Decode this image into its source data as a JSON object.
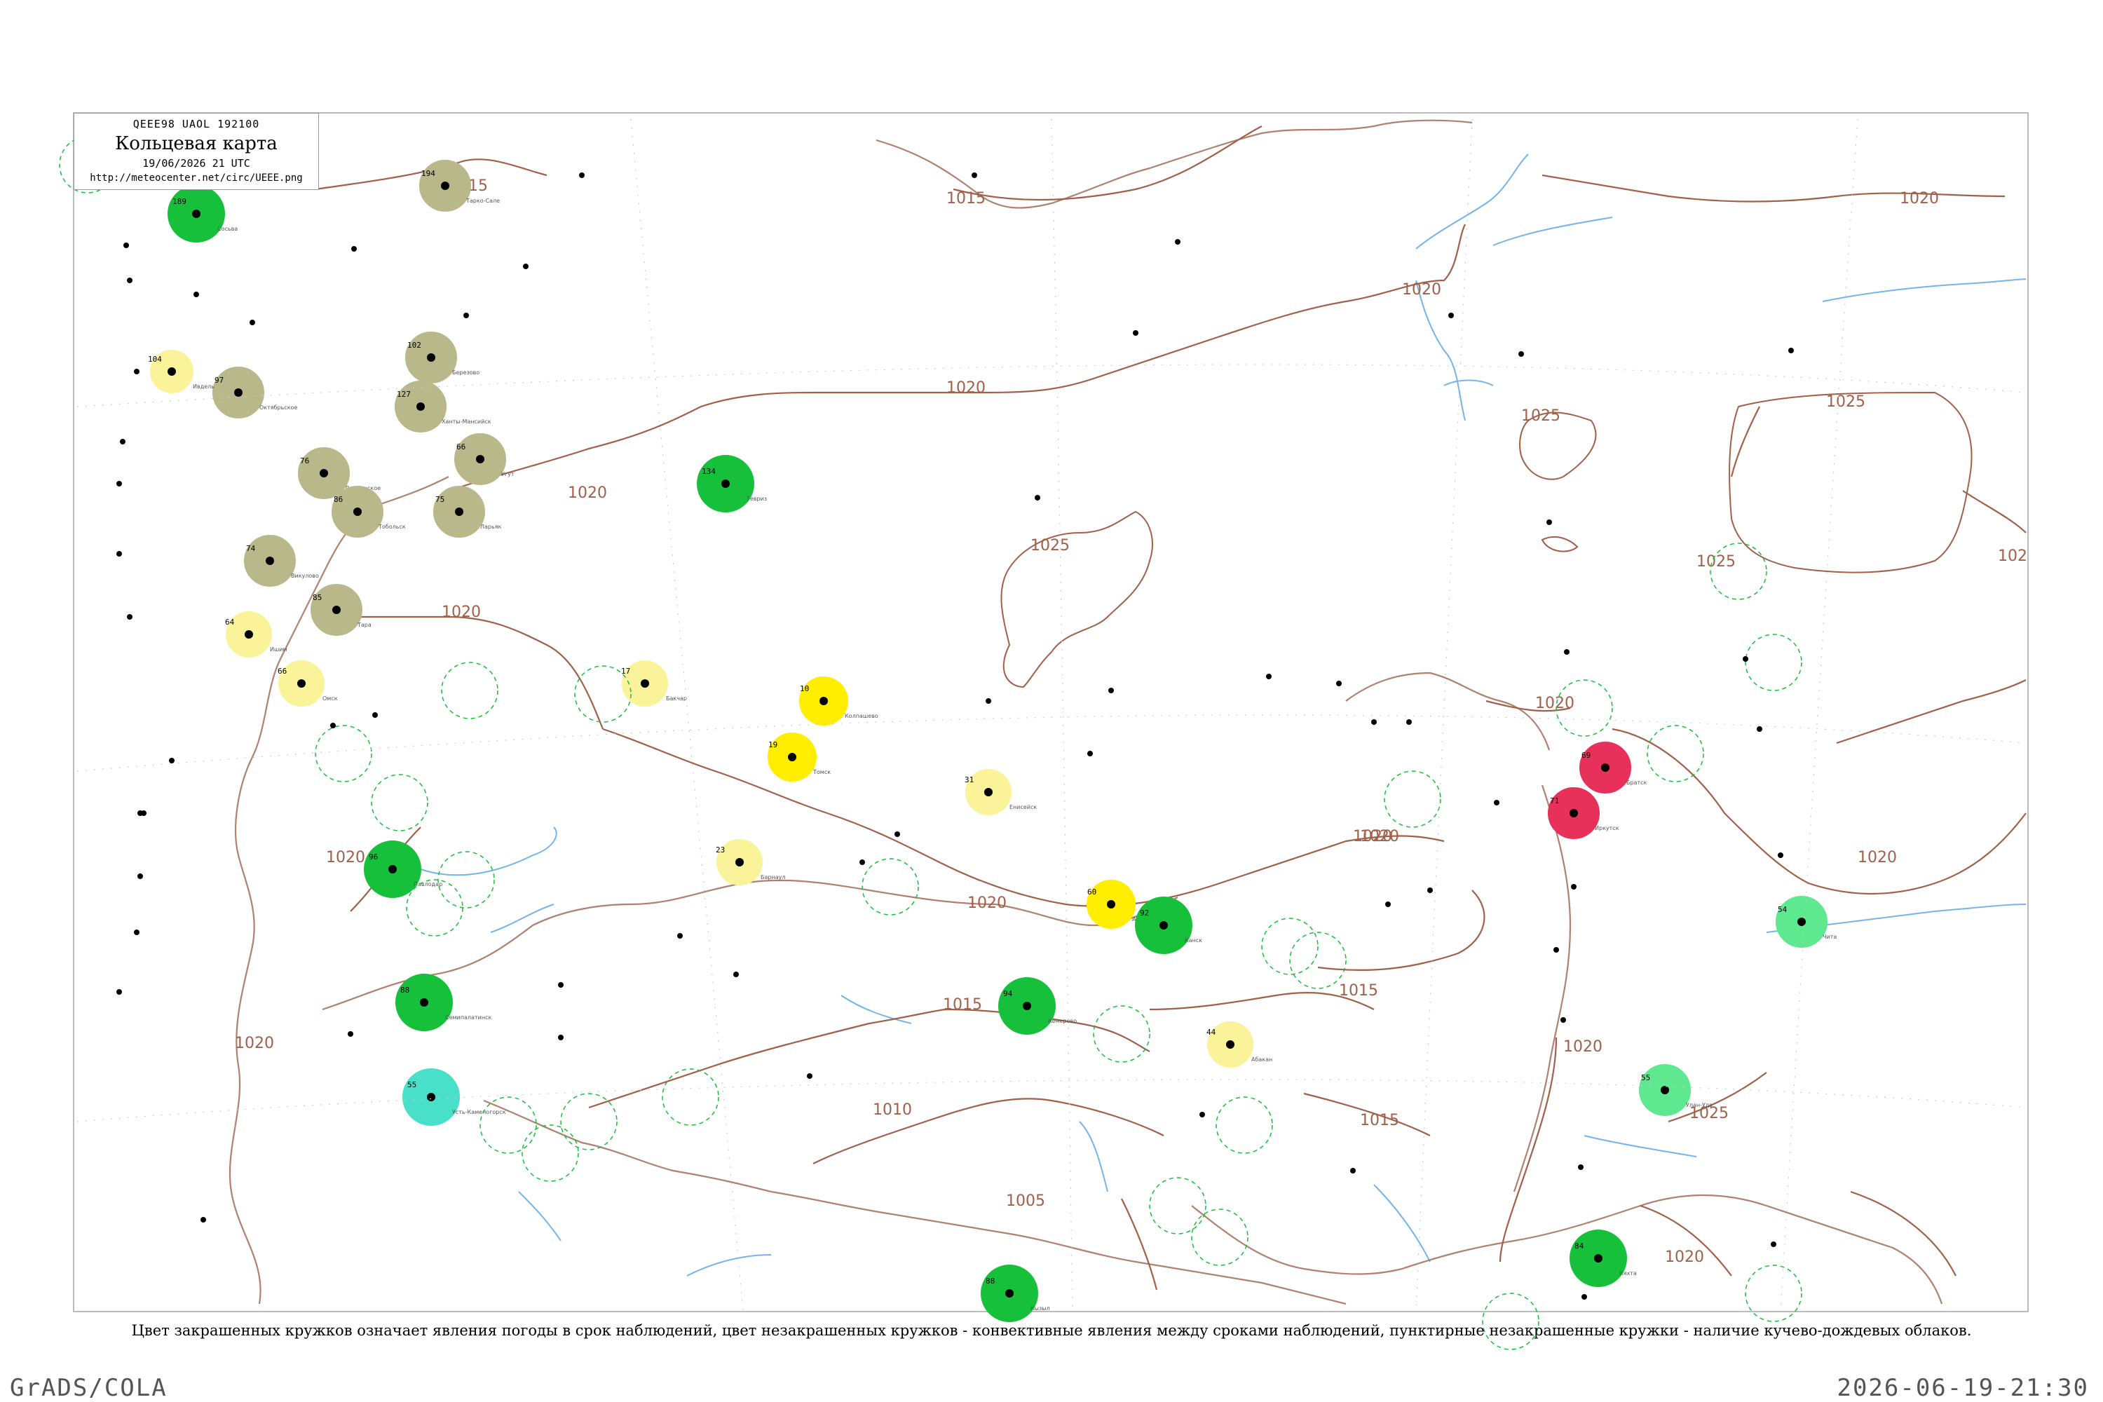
{
  "header": {
    "code_line": "QEEE98  UAOL  192100",
    "title": "Кольцевая карта",
    "date_line": "19/06/2026 21 UTC",
    "url": "http://meteocenter.net/circ/UEEE.png"
  },
  "caption": "Цвет закрашенных кружков означает явления погоды в срок наблюдений, цвет незакрашенных кружков - конвективные явления между сроками наблюдений, пунктирные незакрашенные кружки - наличие кучево-дождевых облаков.",
  "footer": {
    "left": "GrADS/COLA",
    "right": "2026-06-19-21:30"
  },
  "colors": {
    "isobar": "#a0604a",
    "river": "#74b4e8",
    "green_station": "#17c03a",
    "olive_station": "#b9b88a",
    "yellow_station": "#ffee00",
    "pale_yellow_station": "#fbf39a",
    "red_station": "#e8315a",
    "light_green_station": "#5ee890",
    "cyan_station": "#48e0c8"
  },
  "isobar_labels": [
    {
      "text": "1015"
    },
    {
      "text": "1015"
    },
    {
      "text": "1020"
    },
    {
      "text": "1020"
    },
    {
      "text": "1020"
    },
    {
      "text": "1020"
    },
    {
      "text": "1020"
    },
    {
      "text": "1025"
    },
    {
      "text": "1025"
    },
    {
      "text": "1025"
    },
    {
      "text": "1020"
    },
    {
      "text": "1025"
    },
    {
      "text": "102"
    },
    {
      "text": "1020"
    },
    {
      "text": "1020"
    },
    {
      "text": "1020"
    },
    {
      "text": "1020"
    },
    {
      "text": "1015"
    },
    {
      "text": "1020"
    },
    {
      "text": "1015"
    },
    {
      "text": "1010"
    },
    {
      "text": "1005"
    },
    {
      "text": "1015"
    },
    {
      "text": "1020"
    },
    {
      "text": "1025"
    },
    {
      "text": "1020"
    },
    {
      "text": "1020"
    }
  ],
  "stations": [
    {
      "type": "green",
      "num": "189",
      "name": "Сосьва"
    },
    {
      "type": "olive",
      "num": "194",
      "name": "Тарко-Сале"
    },
    {
      "type": "olive",
      "num": "102",
      "name": "Березово"
    },
    {
      "type": "olive",
      "num": "127",
      "name": "Ханты-Мансийск"
    },
    {
      "type": "olive",
      "num": "66",
      "name": "Угут"
    },
    {
      "type": "olive",
      "num": "76",
      "name": "Демьянское"
    },
    {
      "type": "olive",
      "num": "86",
      "name": "Тобольск"
    },
    {
      "type": "olive",
      "num": "75",
      "name": "Ларьяк"
    },
    {
      "type": "olive",
      "num": "97",
      "name": "Октябрьское"
    },
    {
      "type": "olive",
      "num": "74",
      "name": "Викулово"
    },
    {
      "type": "olive",
      "num": "85",
      "name": "Тара"
    },
    {
      "type": "pale_yellow",
      "num": "104",
      "name": "Ивдель"
    },
    {
      "type": "pale_yellow",
      "num": "64",
      "name": "Ишим"
    },
    {
      "type": "pale_yellow",
      "num": "66",
      "name": "Омск"
    },
    {
      "type": "pale_yellow",
      "num": "17",
      "name": "Бакчар"
    },
    {
      "type": "yellow",
      "num": "10",
      "name": "Колпашево"
    },
    {
      "type": "yellow",
      "num": "19",
      "name": "Томск"
    },
    {
      "type": "pale_yellow",
      "num": "31",
      "name": "Енисейск"
    },
    {
      "type": "pale_yellow",
      "num": "23",
      "name": "Барнаул"
    },
    {
      "type": "yellow",
      "num": "60",
      "name": "Ачинск"
    },
    {
      "type": "pale_yellow",
      "num": "44",
      "name": "Абакан"
    },
    {
      "type": "green",
      "num": "134",
      "name": "Тевриз"
    },
    {
      "type": "green",
      "num": "96",
      "name": "Павлодар"
    },
    {
      "type": "green",
      "num": "88",
      "name": "Семипалатинск"
    },
    {
      "type": "cyan",
      "num": "55",
      "name": "Усть-Каменогорск"
    },
    {
      "type": "green",
      "num": "94",
      "name": "Кемерово"
    },
    {
      "type": "green",
      "num": "92",
      "name": "Канск"
    },
    {
      "type": "green",
      "num": "88",
      "name": "Кызыл"
    },
    {
      "type": "red",
      "num": "69",
      "name": "Братск"
    },
    {
      "type": "red",
      "num": "71",
      "name": "Иркутск"
    },
    {
      "type": "light_green",
      "num": "54",
      "name": "Чита"
    },
    {
      "type": "light_green",
      "num": "55",
      "name": "Улан-Удэ"
    },
    {
      "type": "green",
      "num": "84",
      "name": "Кяхта"
    }
  ]
}
